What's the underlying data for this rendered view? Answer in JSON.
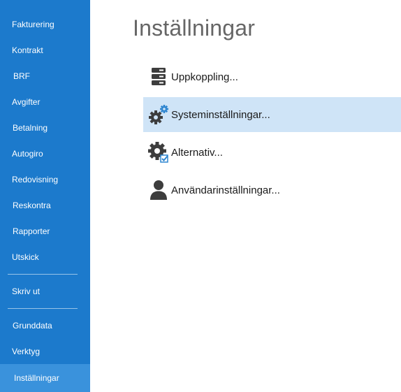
{
  "sidebar": {
    "items": [
      {
        "label": "Fakturering"
      },
      {
        "label": "Kontrakt"
      },
      {
        "label": "BRF"
      },
      {
        "label": "Avgifter"
      },
      {
        "label": "Betalning"
      },
      {
        "label": "Autogiro"
      },
      {
        "label": "Redovisning"
      },
      {
        "label": "Reskontra"
      },
      {
        "label": "Rapporter"
      },
      {
        "label": "Utskick"
      },
      {
        "label": "Skriv ut"
      },
      {
        "label": "Grunddata"
      },
      {
        "label": "Verktyg"
      },
      {
        "label": "Inställningar",
        "active": true
      }
    ]
  },
  "main": {
    "title": "Inställningar",
    "items": [
      {
        "label": "Uppkoppling...",
        "icon": "server-icon"
      },
      {
        "label": "Systeminställningar...",
        "icon": "gears-icon",
        "selected": true
      },
      {
        "label": "Alternativ...",
        "icon": "gear-checkbox-icon"
      },
      {
        "label": "Användarinställningar...",
        "icon": "user-icon"
      }
    ]
  },
  "colors": {
    "sidebar_bg": "#1c7acc",
    "sidebar_active_bg": "#3a92dc",
    "selected_item_bg": "#cfe4f7",
    "title_color": "#666666"
  }
}
